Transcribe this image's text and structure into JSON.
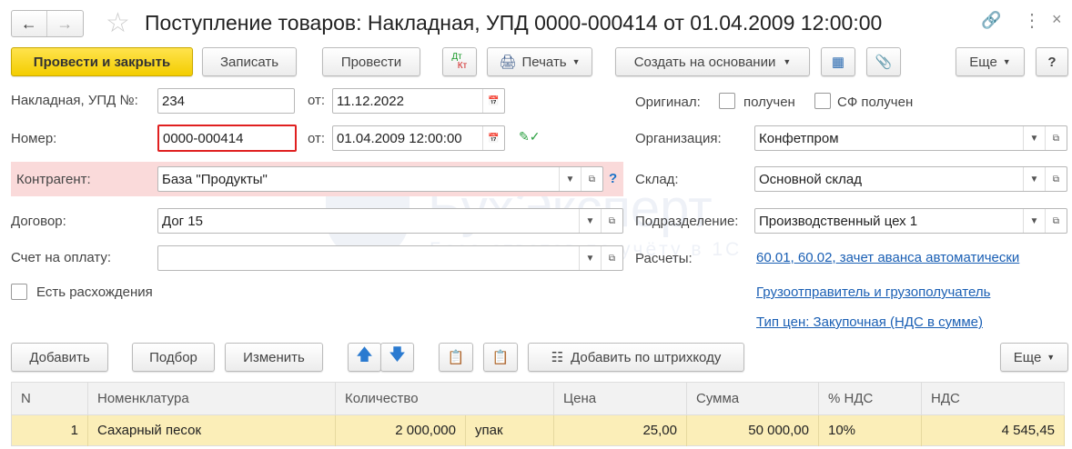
{
  "title": "Поступление товаров: Накладная, УПД 0000-000414 от 01.04.2009 12:00:00",
  "toolbar": {
    "post_close": "Провести и закрыть",
    "save": "Записать",
    "post": "Провести",
    "dtkt_dt": "Дт",
    "dtkt_kt": "Кт",
    "print": "Печать",
    "create_based": "Создать на основании",
    "more": "Еще",
    "help": "?"
  },
  "form": {
    "invoice_label": "Накладная, УПД №:",
    "invoice_no": "234",
    "from_label": "от:",
    "invoice_date": "11.12.2022",
    "number_label": "Номер:",
    "number": "0000-000414",
    "doc_date": "01.04.2009 12:00:00",
    "counterparty_label": "Контрагент:",
    "counterparty": "База \"Продукты\"",
    "help_q": "?",
    "contract_label": "Договор:",
    "contract": "Дог 15",
    "payment_invoice_label": "Счет на оплату:",
    "payment_invoice": "",
    "discrepancy_label": "Есть расхождения",
    "original_label": "Оригинал:",
    "received": "получен",
    "sf_received": "СФ получен",
    "org_label": "Организация:",
    "org": "Конфетпром",
    "warehouse_label": "Склад:",
    "warehouse": "Основной склад",
    "division_label": "Подразделение:",
    "division": "Производственный цех 1",
    "settlements_label": "Расчеты:",
    "settlements_link": "60.01, 60.02, зачет аванса автоматически",
    "shipper_link": "Грузоотправитель и грузополучатель",
    "price_type_link": "Тип цен: Закупочная (НДС в сумме)"
  },
  "table_toolbar": {
    "add": "Добавить",
    "pick": "Подбор",
    "edit": "Изменить",
    "barcode": "Добавить по штрихкоду",
    "more": "Еще"
  },
  "table": {
    "headers": [
      "N",
      "Номенклатура",
      "Количество",
      "",
      "Цена",
      "Сумма",
      "% НДС",
      "НДС"
    ],
    "rows": [
      [
        "1",
        "Сахарный песок",
        "2 000,000",
        "упак",
        "25,00",
        "50 000,00",
        "10%",
        "4 545,45"
      ]
    ]
  },
  "watermark": {
    "brand": "БухЭксперт 8",
    "tagline": "База ответов по учёту в 1С"
  }
}
